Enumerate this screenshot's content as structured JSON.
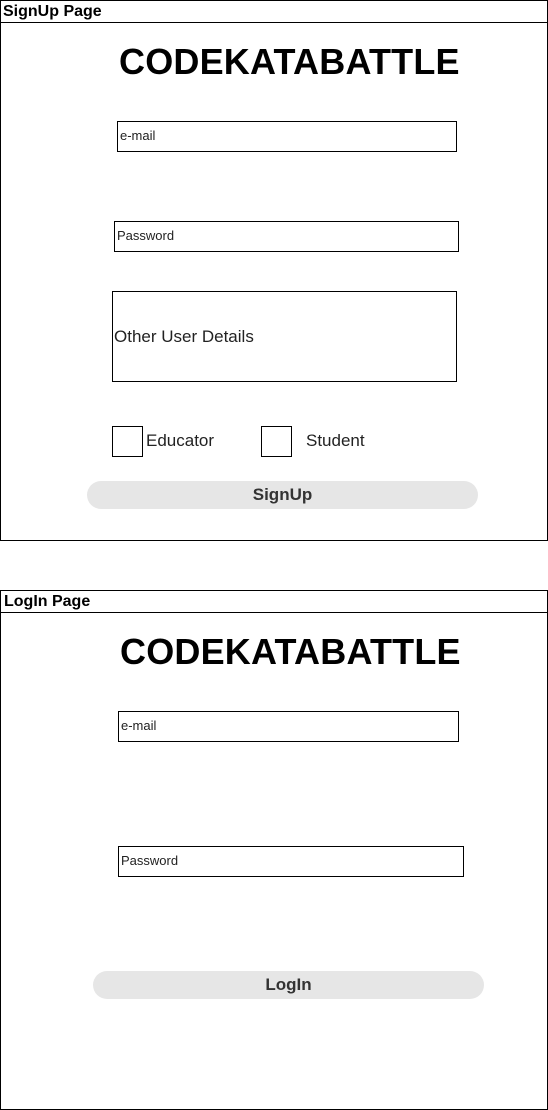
{
  "signup": {
    "header": "SignUp Page",
    "title": "CODEKATABATTLE",
    "email_placeholder": "e-mail",
    "password_placeholder": "Password",
    "other_details": "Other User Details",
    "role_educator": "Educator",
    "role_student": "Student",
    "submit_label": "SignUp"
  },
  "login": {
    "header": "LogIn Page",
    "title": "CODEKATABATTLE",
    "email_placeholder": "e-mail",
    "password_placeholder": "Password",
    "submit_label": "LogIn"
  }
}
